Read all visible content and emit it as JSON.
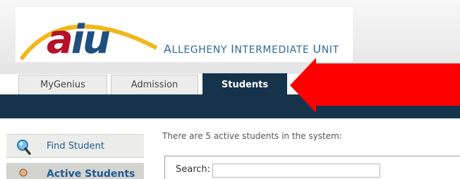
{
  "header": {
    "logo_part1": "a",
    "logo_part2": "iu",
    "org_name_cap1": "A",
    "org_name_rest1": "LLEGHENY ",
    "org_name_cap2": "I",
    "org_name_rest2": "NTERMEDIATE ",
    "org_name_cap3": "U",
    "org_name_rest3": "NIT",
    "colors": {
      "logo_red": "#b3122a",
      "logo_blue": "#1e4f7e",
      "logo_arc": "#f2b71c",
      "org_name": "#2e6a9a"
    }
  },
  "tabs": [
    {
      "label": "MyGenius",
      "active": false
    },
    {
      "label": "Admission",
      "active": false
    },
    {
      "label": "Students",
      "active": true
    }
  ],
  "nav_bar_color": "#16334c",
  "annotation": {
    "icon": "red-arrow-icon",
    "color": "#ff0000"
  },
  "sidebar": {
    "items": [
      {
        "label": "Find Student",
        "icon": "magnifier-icon",
        "selected": false
      },
      {
        "label": "Active Students",
        "icon": "student-icon",
        "selected": true
      }
    ]
  },
  "main": {
    "status_text": "There are 5 active students in the system:",
    "search_label": "Search:",
    "search_value": ""
  }
}
